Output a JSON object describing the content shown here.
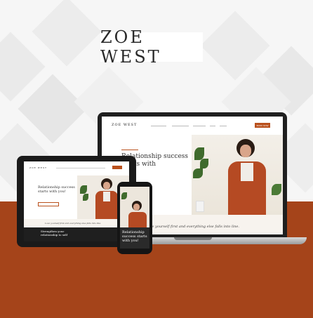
{
  "brand": {
    "name": "ZOE WEST"
  },
  "colors": {
    "accent": "#b9501c",
    "accent_dark": "#a5441a",
    "jacket": "#b54a23"
  },
  "laptop": {
    "logo": "ZOE WEST",
    "nav_items": [
      "",
      "",
      "",
      "",
      ""
    ],
    "book_button": "BOOK NOW",
    "hero_heading": "Relationship success starts with",
    "quote": "love yourself first and everything else falls into line."
  },
  "tablet": {
    "logo": "ZOE WEST",
    "hero_heading": "Relationship success starts with you!",
    "quote": "Love yourself first and everything else falls into line.",
    "sub_heading": "Strengthen your relationship to self"
  },
  "phone": {
    "hero_heading": "Relationship success starts with you!"
  }
}
